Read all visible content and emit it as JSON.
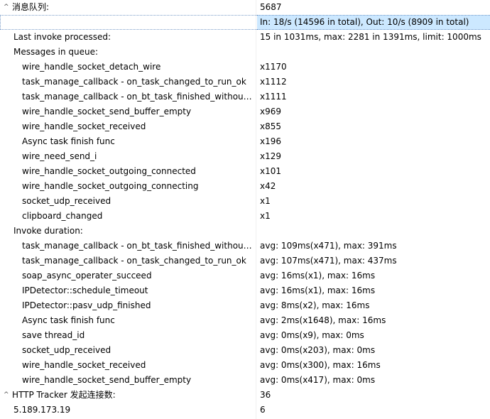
{
  "rows": [
    {
      "name": "message-queue-header",
      "label": "消息队列:",
      "value": "5687",
      "level": 0,
      "expander": "^"
    },
    {
      "name": "throughput-row",
      "label": "",
      "value": "In: 18/s (14596 in total), Out: 10/s (8909 in total)",
      "level": 1,
      "selected": true
    },
    {
      "name": "last-invoke-row",
      "label": "Last invoke processed:",
      "value": "15 in 1031ms, max: 2281 in 1391ms, limit: 1000ms",
      "level": 1
    },
    {
      "name": "messages-in-queue-header",
      "label": "Messages in queue:",
      "value": "",
      "level": 1
    },
    {
      "name": "queue-item",
      "label": "wire_handle_socket_detach_wire",
      "value": "x1170",
      "level": 2
    },
    {
      "name": "queue-item",
      "label": "task_manage_callback - on_task_changed_to_run_ok",
      "value": "x1112",
      "level": 2
    },
    {
      "name": "queue-item",
      "label": "task_manage_callback - on_bt_task_finished_without_d...",
      "value": "x1111",
      "level": 2
    },
    {
      "name": "queue-item",
      "label": "wire_handle_socket_send_buffer_empty",
      "value": "x969",
      "level": 2
    },
    {
      "name": "queue-item",
      "label": "wire_handle_socket_received",
      "value": "x855",
      "level": 2
    },
    {
      "name": "queue-item",
      "label": "Async task finish func",
      "value": "x196",
      "level": 2
    },
    {
      "name": "queue-item",
      "label": "wire_need_send_i",
      "value": "x129",
      "level": 2
    },
    {
      "name": "queue-item",
      "label": "wire_handle_socket_outgoing_connected",
      "value": "x101",
      "level": 2
    },
    {
      "name": "queue-item",
      "label": "wire_handle_socket_outgoing_connecting",
      "value": "x42",
      "level": 2
    },
    {
      "name": "queue-item",
      "label": "socket_udp_received",
      "value": "x1",
      "level": 2
    },
    {
      "name": "queue-item",
      "label": "clipboard_changed",
      "value": "x1",
      "level": 2
    },
    {
      "name": "invoke-duration-header",
      "label": "Invoke duration:",
      "value": "",
      "level": 1
    },
    {
      "name": "duration-item",
      "label": "task_manage_callback - on_bt_task_finished_without_d...",
      "value": "avg: 109ms(x471), max: 391ms",
      "level": 2
    },
    {
      "name": "duration-item",
      "label": "task_manage_callback - on_task_changed_to_run_ok",
      "value": "avg: 107ms(x471), max: 437ms",
      "level": 2
    },
    {
      "name": "duration-item",
      "label": "soap_async_operater_succeed",
      "value": "avg: 16ms(x1), max: 16ms",
      "level": 2
    },
    {
      "name": "duration-item",
      "label": "IPDetector::schedule_timeout",
      "value": "avg: 16ms(x1), max: 16ms",
      "level": 2
    },
    {
      "name": "duration-item",
      "label": "IPDetector::pasv_udp_finished",
      "value": "avg: 8ms(x2), max: 16ms",
      "level": 2
    },
    {
      "name": "duration-item",
      "label": "Async task finish func",
      "value": "avg: 2ms(x1648), max: 16ms",
      "level": 2
    },
    {
      "name": "duration-item",
      "label": "save thread_id",
      "value": "avg: 0ms(x9), max: 0ms",
      "level": 2
    },
    {
      "name": "duration-item",
      "label": "socket_udp_received",
      "value": "avg: 0ms(x203), max: 0ms",
      "level": 2
    },
    {
      "name": "duration-item",
      "label": "wire_handle_socket_received",
      "value": "avg: 0ms(x300), max: 16ms",
      "level": 2
    },
    {
      "name": "duration-item",
      "label": "wire_handle_socket_send_buffer_empty",
      "value": "avg: 0ms(x417), max: 0ms",
      "level": 2
    },
    {
      "name": "http-tracker-header",
      "label": "HTTP Tracker 发起连接数:",
      "value": "36",
      "level": 0,
      "expander": "^"
    },
    {
      "name": "tracker-ip-row",
      "label": "5.189.173.19",
      "value": "6",
      "level": 1
    }
  ]
}
